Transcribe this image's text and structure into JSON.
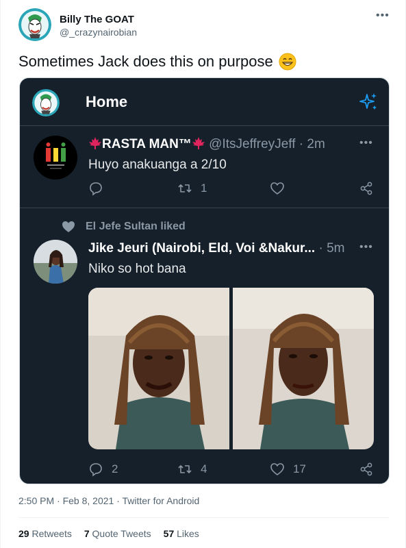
{
  "tweet": {
    "author_name": "Billy The GOAT",
    "author_handle": "@_crazynairobian",
    "more_icon": "more-icon",
    "text": "Sometimes Jack does this on purpose",
    "emoji": "grinning-face-emoji",
    "timestamp": "2:50 PM · Feb 8, 2021 · Twitter for Android",
    "stats": {
      "retweets_count": "29",
      "retweets_label": "Retweets",
      "quotes_count": "7",
      "quotes_label": "Quote Tweets",
      "likes_count": "57",
      "likes_label": "Likes"
    }
  },
  "screenshot": {
    "header": {
      "title": "Home",
      "sparkle_icon": "sparkle-icon"
    },
    "tweet1": {
      "name": "RASTA MAN™",
      "handle": "@ItsJeffreyJeff",
      "time": "· 2m",
      "text": "Huyo anakuanga a 2/10",
      "reply_count": "",
      "retweet_count": "1",
      "like_count": ""
    },
    "tweet2": {
      "liked_by": "El Jefe Sultan liked",
      "name": "Jike Jeuri (Nairobi, Eld, Voi &Nakur...",
      "time": "· 5m",
      "text": "Niko so hot bana",
      "reply_count": "2",
      "retweet_count": "4",
      "like_count": "17"
    }
  },
  "colors": {
    "dark_bg": "#15202b",
    "twitter_blue": "#1d9bf0",
    "muted": "#8b98a5"
  }
}
